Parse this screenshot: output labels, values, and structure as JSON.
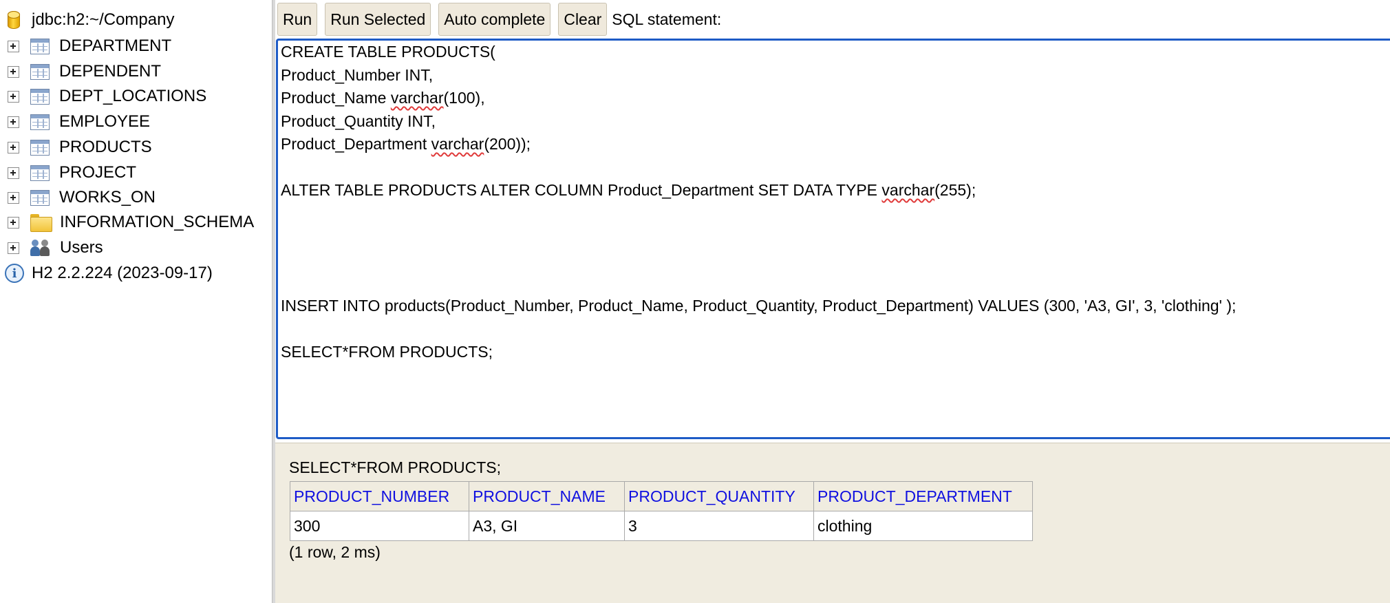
{
  "tree": {
    "connection": "jdbc:h2:~/Company",
    "items": [
      {
        "label": "DEPARTMENT",
        "icon": "table-icon"
      },
      {
        "label": "DEPENDENT",
        "icon": "table-icon"
      },
      {
        "label": "DEPT_LOCATIONS",
        "icon": "table-icon"
      },
      {
        "label": "EMPLOYEE",
        "icon": "table-icon"
      },
      {
        "label": "PRODUCTS",
        "icon": "table-icon"
      },
      {
        "label": "PROJECT",
        "icon": "table-icon"
      },
      {
        "label": "WORKS_ON",
        "icon": "table-icon"
      },
      {
        "label": "INFORMATION_SCHEMA",
        "icon": "folder-icon"
      },
      {
        "label": "Users",
        "icon": "users-icon"
      }
    ],
    "version": "H2 2.2.224 (2023-09-17)"
  },
  "toolbar": {
    "run_label": "Run",
    "run_selected_label": "Run Selected",
    "auto_complete_label": "Auto complete",
    "clear_label": "Clear",
    "sql_statement_label": "SQL statement:"
  },
  "editor": {
    "lines": [
      "CREATE TABLE PRODUCTS(",
      "Product_Number INT,",
      "Product_Name ",
      "varchar",
      "(100),",
      "Product_Quantity INT,",
      "Product_Department ",
      "varchar",
      "(200));",
      "ALTER TABLE PRODUCTS ALTER COLUMN Product_Department SET DATA TYPE ",
      "varchar",
      "(255);",
      "INSERT INTO products(Product_Number, Product_Name, Product_Quantity, Product_Department) VALUES (300, 'A3, GI', 3, 'clothing' );",
      "SELECT*FROM PRODUCTS;"
    ]
  },
  "results": {
    "statement": "SELECT*FROM PRODUCTS;",
    "columns": [
      "PRODUCT_NUMBER",
      "PRODUCT_NAME",
      "PRODUCT_QUANTITY",
      "PRODUCT_DEPARTMENT"
    ],
    "rows": [
      [
        "300",
        "A3, GI",
        "3",
        "clothing"
      ]
    ],
    "summary": "(1 row, 2 ms)"
  },
  "colors": {
    "editor_border": "#1e5bc6",
    "results_background": "#f0ece0",
    "column_header_text": "#1010e0",
    "spellcheck_underline": "#e03a3a"
  }
}
